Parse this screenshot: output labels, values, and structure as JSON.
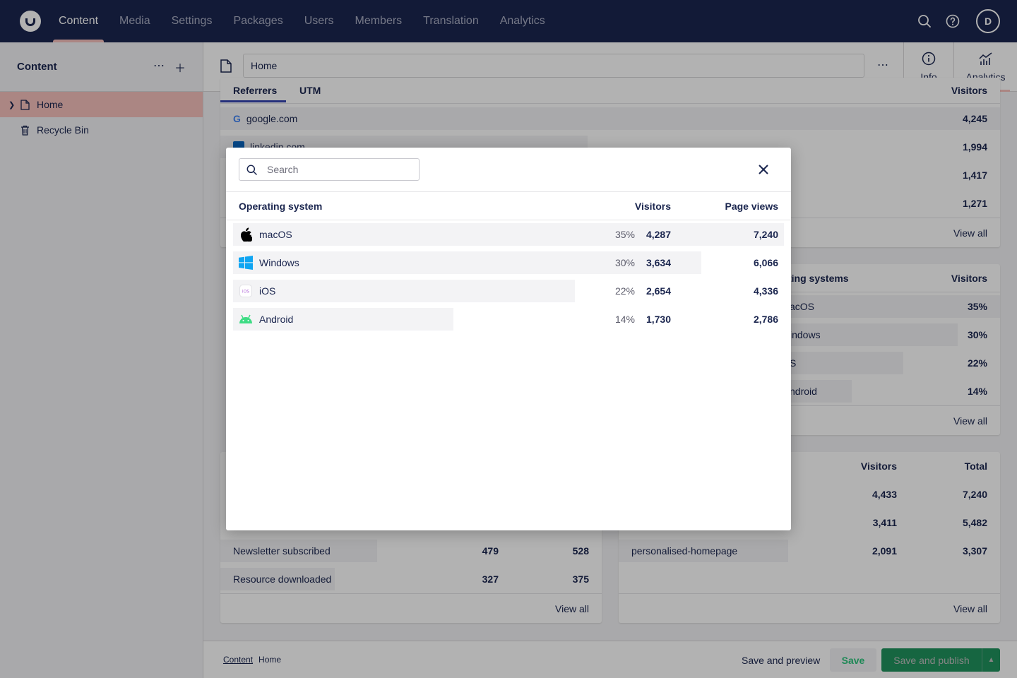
{
  "header": {
    "nav": [
      "Content",
      "Media",
      "Settings",
      "Packages",
      "Users",
      "Members",
      "Translation",
      "Analytics"
    ],
    "active_nav": "Content",
    "avatar": "D"
  },
  "sidebar": {
    "title": "Content",
    "items": [
      {
        "label": "Home",
        "active": true
      },
      {
        "label": "Recycle Bin",
        "active": false
      }
    ]
  },
  "workspace": {
    "name": "Home",
    "tabs": [
      {
        "label": "Info"
      },
      {
        "label": "Analytics"
      }
    ]
  },
  "background": {
    "referrers": {
      "tab_labels": [
        "Referrers",
        "UTM"
      ],
      "column": "Visitors",
      "rows": [
        {
          "label": "google.com",
          "value": "4,245"
        },
        {
          "label": "linkedin.com",
          "value": "1,994"
        },
        {
          "label": "",
          "value": "1,417"
        },
        {
          "label": "",
          "value": "1,271"
        }
      ],
      "view_all": "View all"
    },
    "os_panel": {
      "title_fragment": "ting systems",
      "column": "Visitors",
      "rows": [
        {
          "label": "acOS",
          "value": "35%"
        },
        {
          "label": "indows",
          "value": "30%"
        },
        {
          "label": "S",
          "value": "22%"
        },
        {
          "label": "ndroid",
          "value": "14%"
        }
      ],
      "view_all": "View all"
    },
    "goals": {
      "rows": [
        {
          "label": "Newsletter subscribed",
          "a": "479",
          "b": "528"
        },
        {
          "label": "Resource downloaded",
          "a": "327",
          "b": "375"
        }
      ],
      "view_all": "View all"
    },
    "campaigns": {
      "columns": [
        "Visitors",
        "Total"
      ],
      "rows": [
        {
          "label": "",
          "a": "4,433",
          "b": "7,240"
        },
        {
          "label": "",
          "a": "3,411",
          "b": "5,482"
        },
        {
          "label": "personalised-homepage",
          "a": "2,091",
          "b": "3,307"
        }
      ],
      "view_all": "View all"
    }
  },
  "footer": {
    "breadcrumb": [
      "Content",
      "Home"
    ],
    "save_preview": "Save and preview",
    "save": "Save",
    "save_publish": "Save and publish"
  },
  "modal": {
    "search_placeholder": "Search",
    "columns": {
      "name": "Operating system",
      "visitors": "Visitors",
      "pageviews": "Page views"
    },
    "rows": [
      {
        "name": "macOS",
        "icon": "apple-icon",
        "pct": "35%",
        "visitors": "4,287",
        "pageviews": "7,240",
        "share": 1.0
      },
      {
        "name": "Windows",
        "icon": "windows-icon",
        "pct": "30%",
        "visitors": "3,634",
        "pageviews": "6,066",
        "share": 0.85
      },
      {
        "name": "iOS",
        "icon": "ios-icon",
        "pct": "22%",
        "visitors": "2,654",
        "pageviews": "4,336",
        "share": 0.62
      },
      {
        "name": "Android",
        "icon": "android-icon",
        "pct": "14%",
        "visitors": "1,730",
        "pageviews": "2,786",
        "share": 0.4
      }
    ]
  },
  "colors": {
    "topbar": "#1b264f",
    "accent": "#f5c1bc",
    "publish": "#2bc37c"
  }
}
